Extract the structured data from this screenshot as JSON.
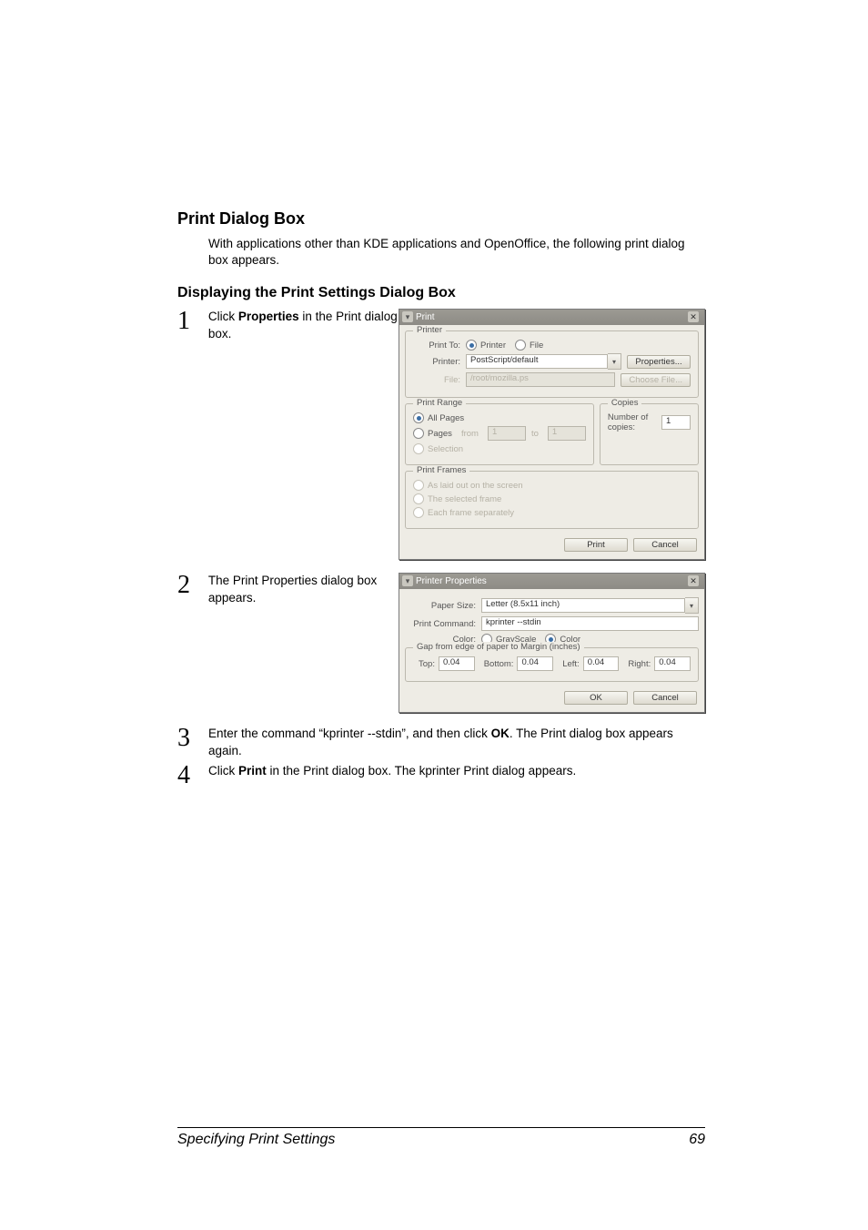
{
  "section": {
    "title": "Print Dialog Box",
    "body": "With applications other than KDE applications and OpenOffice, the following print dialog box appears."
  },
  "subsection": {
    "title": "Displaying the Print Settings Dialog Box"
  },
  "steps": [
    {
      "num": "1",
      "pre": "Click ",
      "bold": "Properties",
      "post": " in the Print dialog box."
    },
    {
      "num": "2",
      "text": "The Print Properties dialog box appears."
    },
    {
      "num": "3",
      "pre": "Enter the command “kprinter --stdin”, and then click ",
      "bold": "OK",
      "post": ". The Print dialog box appears again."
    },
    {
      "num": "4",
      "pre": "Click ",
      "bold": "Print",
      "post": " in the Print dialog box. The kprinter Print dialog appears."
    }
  ],
  "dlg1": {
    "title": "Print",
    "printer_group": "Printer",
    "print_to_lab": "Print To:",
    "printer_radio": "Printer",
    "file_radio": "File",
    "printer_lab": "Printer:",
    "printer_val": "PostScript/default",
    "properties_btn": "Properties...",
    "file_lab": "File:",
    "file_val": "/root/mozilla.ps",
    "choose_file_btn": "Choose File...",
    "range_group": "Print Range",
    "all_pages": "All Pages",
    "pages_lab": "Pages",
    "from_lab": "from",
    "from_val": "1",
    "to_lab": "to",
    "to_val": "1",
    "selection_lab": "Selection",
    "copies_group": "Copies",
    "copies_lab": "Number of copies:",
    "copies_val": "1",
    "frames_group": "Print Frames",
    "frame_aslaid": "As laid out on the screen",
    "frame_selected": "The selected frame",
    "frame_each": "Each frame separately",
    "print_btn": "Print",
    "cancel_btn": "Cancel"
  },
  "dlg2": {
    "title": "Printer Properties",
    "paper_lab": "Paper Size:",
    "paper_val": "Letter (8.5x11 inch)",
    "cmd_lab": "Print Command:",
    "cmd_val": "kprinter --stdin",
    "color_lab": "Color:",
    "gray_radio": "GrayScale",
    "color_radio": "Color",
    "gap_group": "Gap from edge of paper to Margin (inches)",
    "top_lab": "Top:",
    "top_val": "0.04",
    "bottom_lab": "Bottom:",
    "bottom_val": "0.04",
    "left_lab": "Left:",
    "left_val": "0.04",
    "right_lab": "Right:",
    "right_val": "0.04",
    "ok_btn": "OK",
    "cancel_btn": "Cancel"
  },
  "footer": {
    "label": "Specifying Print Settings",
    "page": "69"
  }
}
